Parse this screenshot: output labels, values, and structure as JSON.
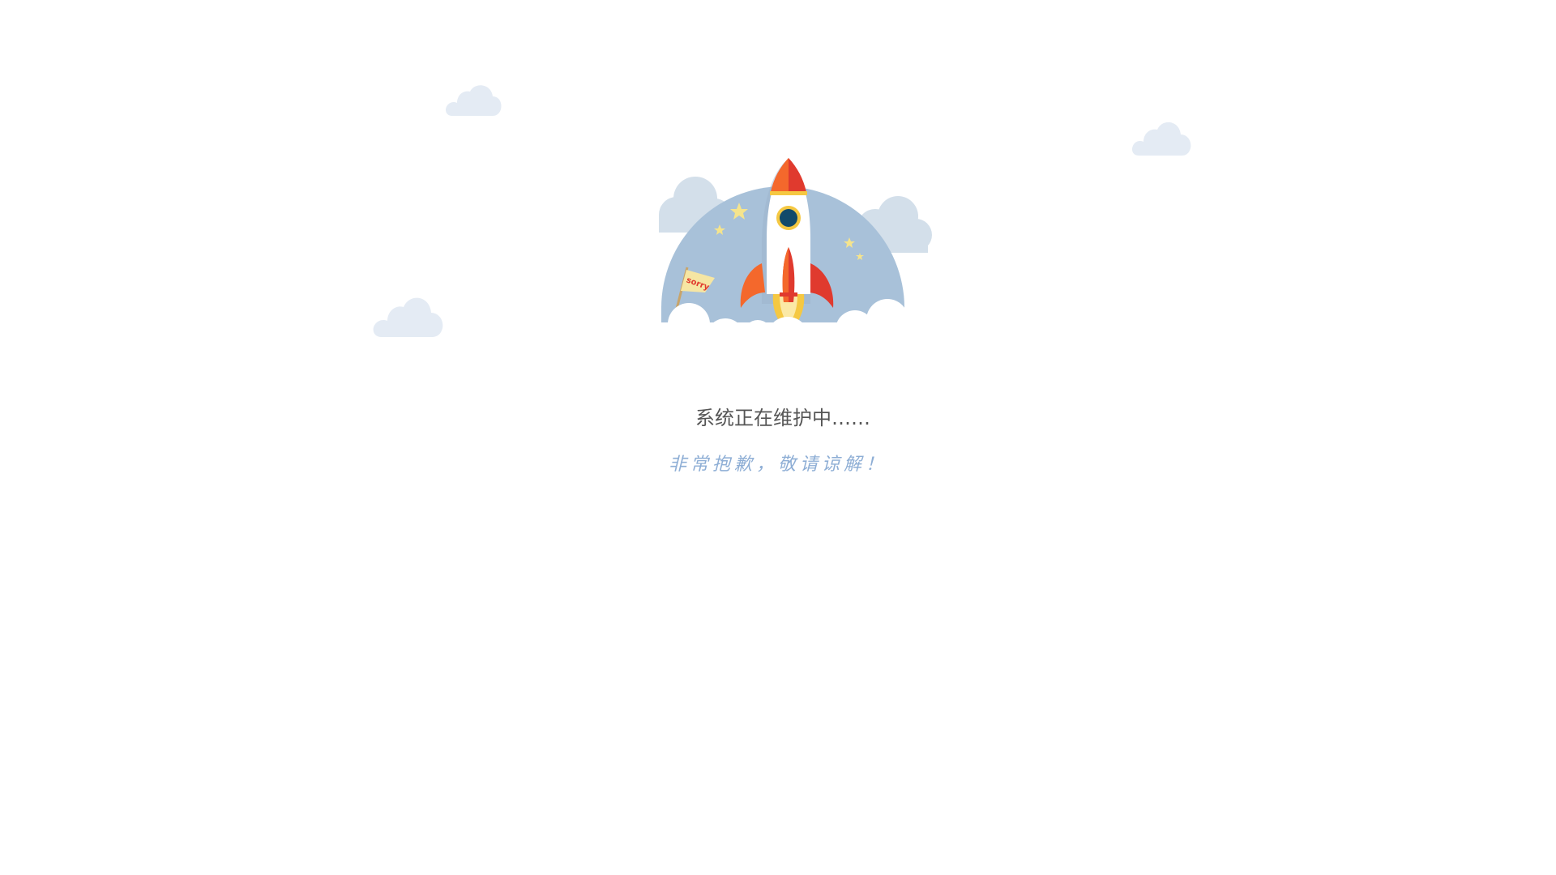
{
  "maintenance": {
    "title": "系统正在维护中……",
    "subtitle": "非常抱歉，敬请谅解！",
    "flag_text": "sorry"
  },
  "colors": {
    "background": "#ffffff",
    "dome": "#a8c1d9",
    "cloud": "#e4ebf4",
    "side_cloud": "#d3dfea",
    "rocket_body": "#ffffff",
    "rocket_red": "#e03a2e",
    "rocket_orange": "#f4682c",
    "flame": "#f5c842",
    "window": "#124a6a",
    "star": "#f5e48d",
    "flag": "#f6e6a3",
    "title_text": "#555555",
    "subtitle_text": "#8eaed5"
  },
  "icons": [
    "cloud-icon",
    "rocket-icon",
    "star-icon",
    "sorry-flag-icon"
  ]
}
